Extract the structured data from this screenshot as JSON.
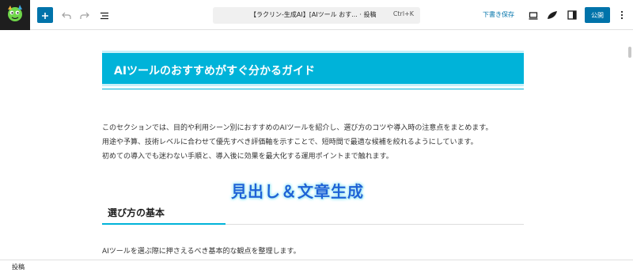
{
  "toolbar": {
    "site_icon": "plugin-mascot-logo",
    "add_icon": "plus-icon",
    "undo_icon": "undo-icon",
    "redo_icon": "redo-icon",
    "outline_icon": "document-outline-icon",
    "command_title": "【ラクリン-生成AI】[AIツール おす... · 投稿",
    "command_shortcut": "Ctrl+K",
    "save_draft_label": "下書き保存",
    "preview_icon": "desktop-preview-icon",
    "plugin_icon": "leaf-plugin-icon",
    "settings_icon": "sidebar-toggle-icon",
    "publish_label": "公開",
    "more_icon": "more-vertical-icon",
    "accent_color": "#0073aa"
  },
  "content": {
    "heading_h2": "AIツールのおすすめがすぐ分かるガイド",
    "paragraph_1": "このセクションでは、目的や利用シーン別におすすめのAIツールを紹介し、選び方のコツや導入時の注意点をまとめます。\n用途や予算、技術レベルに合わせて優先すべき評価軸を示すことで、短時間で最適な候補を絞れるようにしています。\n初めての導入でも迷わない手順と、導入後に効果を最大化する運用ポイントまで触れます。",
    "overlay_caption": "見出し＆文章生成",
    "heading_h3": "選び方の基本",
    "paragraph_2": "AIツールを選ぶ際に押さえるべき基本的な観点を整理します。",
    "heading_color": "#00b3d9"
  },
  "footer": {
    "breadcrumb": "投稿"
  }
}
